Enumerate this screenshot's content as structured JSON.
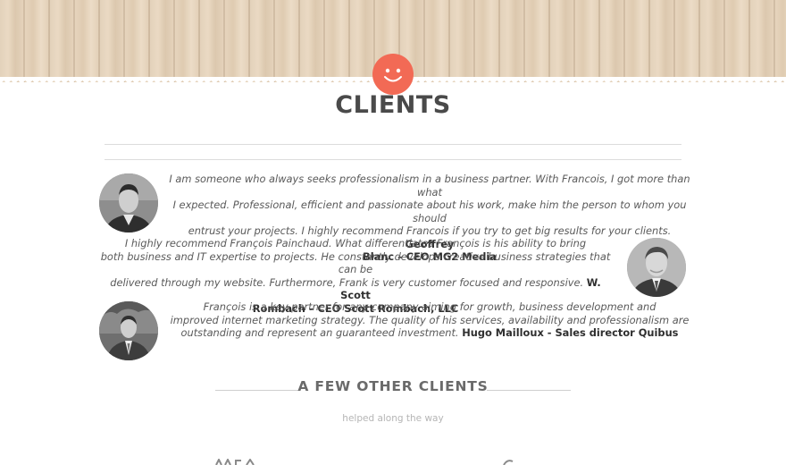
{
  "header": {
    "smiley_icon": "smiley-face-icon",
    "accent_color": "#f26a55"
  },
  "clients": {
    "title": "CLIENTS",
    "testimonials": [
      {
        "lines": [
          "I am someone who always seeks professionalism in a business partner. With Francois, I got more than what",
          "I expected. Professional, efficient and passionate about his work, make him the person to whom you should",
          "entrust your projects. I highly recommend Francois if you try to get big results for your clients."
        ],
        "author_a": "Geoffrey",
        "author_b": "Blanc – CEO MG2 Media"
      },
      {
        "lines": [
          "I highly recommend François Painchaud. What differentiates François is his ability to bring",
          "both business and IT expertise to projects. He constantly develops creative business strategies that can be",
          "delivered through my website. Furthermore, Frank is very customer focused and responsive."
        ],
        "author_a": "W. Scott",
        "author_b": "Rombach – CEO Scott Rombach, LLC"
      },
      {
        "lines": [
          "François is a key partner for any company aiming for growth, business development and",
          "improved internet marketing strategy. The quality of his services, availability and professionalism are",
          "outstanding and represent an guaranteed investment."
        ],
        "author_a": "Hugo Mailloux - Sales director Quibus"
      }
    ]
  },
  "other_clients": {
    "title": "A FEW OTHER CLIENTS",
    "subtitle": "helped along the way"
  }
}
